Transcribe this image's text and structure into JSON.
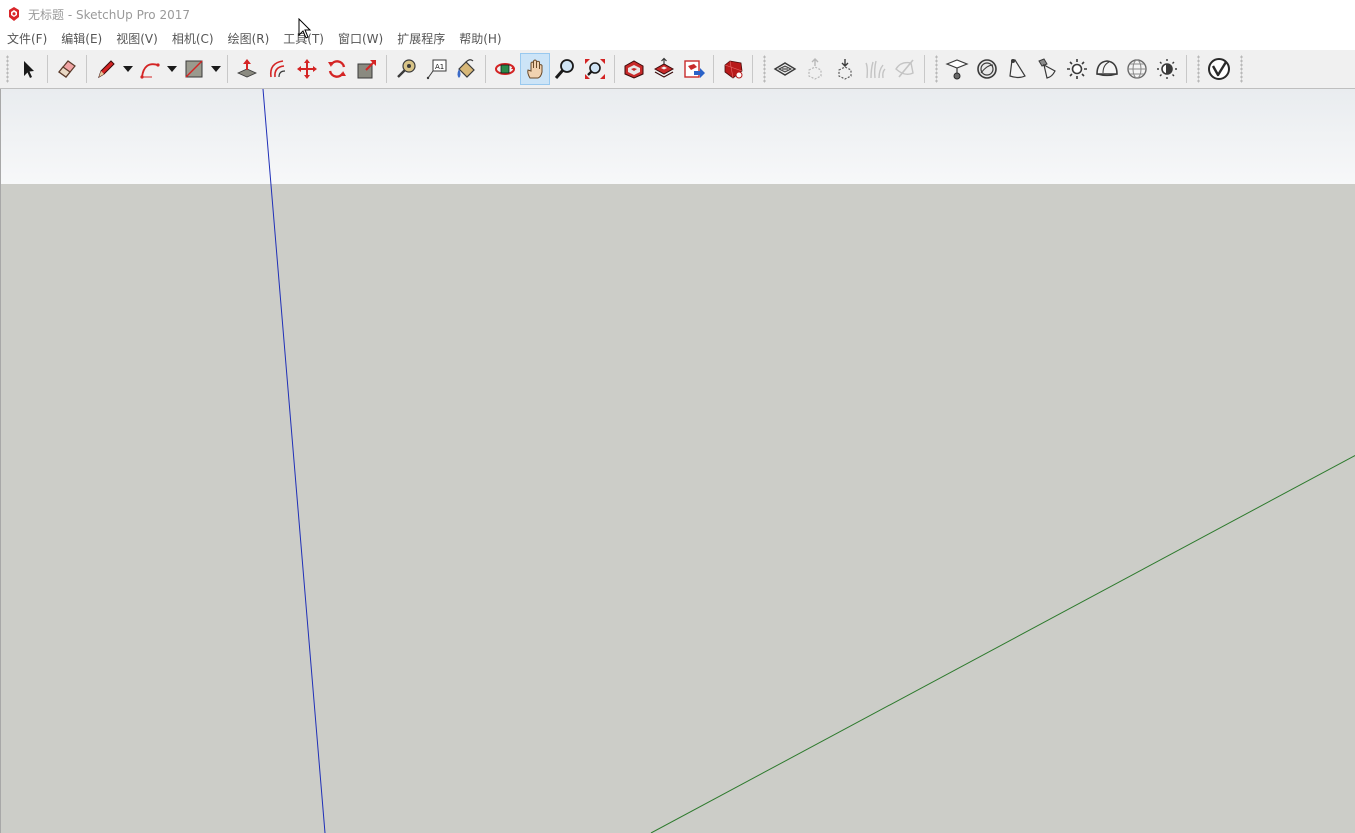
{
  "window": {
    "title": "无标题 - SketchUp Pro 2017",
    "app_icon": "sketchup-logo-icon"
  },
  "menu": [
    {
      "label": "文件(F)"
    },
    {
      "label": "编辑(E)"
    },
    {
      "label": "视图(V)"
    },
    {
      "label": "相机(C)"
    },
    {
      "label": "绘图(R)"
    },
    {
      "label": "工具(T)"
    },
    {
      "label": "窗口(W)"
    },
    {
      "label": "扩展程序"
    },
    {
      "label": "帮助(H)"
    }
  ],
  "toolbar": {
    "tools": [
      {
        "icon": "select-arrow-icon"
      },
      {
        "icon": "eraser-icon"
      },
      {
        "icon": "pencil-line-icon"
      },
      {
        "icon": "arc-icon"
      },
      {
        "icon": "rectangle-shape-icon"
      },
      {
        "icon": "push-pull-icon"
      },
      {
        "icon": "offset-icon"
      },
      {
        "icon": "move-icon"
      },
      {
        "icon": "rotate-icon"
      },
      {
        "icon": "scale-icon"
      },
      {
        "icon": "tape-measure-icon"
      },
      {
        "icon": "text-label-icon"
      },
      {
        "icon": "paint-bucket-icon"
      },
      {
        "icon": "orbit-icon"
      },
      {
        "icon": "pan-hand-icon",
        "active": true
      },
      {
        "icon": "zoom-icon"
      },
      {
        "icon": "zoom-extents-icon"
      },
      {
        "icon": "3d-warehouse-icon"
      },
      {
        "icon": "share-model-icon"
      },
      {
        "icon": "extension-warehouse-icon"
      },
      {
        "icon": "ruby-extension-icon"
      },
      {
        "icon": "section-plane-icon"
      },
      {
        "icon": "add-location-icon"
      },
      {
        "icon": "preview-terrain-icon"
      },
      {
        "icon": "sandbox-grass-icon"
      },
      {
        "icon": "section-cut-icon"
      },
      {
        "icon": "vray-camera-icon"
      },
      {
        "icon": "vray-sphere-light-icon"
      },
      {
        "icon": "vray-spot-light-icon"
      },
      {
        "icon": "vray-ies-light-icon"
      },
      {
        "icon": "vray-omni-light-icon"
      },
      {
        "icon": "vray-dome-light-icon"
      },
      {
        "icon": "vray-sphere-mesh-icon"
      },
      {
        "icon": "vray-mesh-light-icon"
      },
      {
        "icon": "vray-logo-icon"
      }
    ]
  },
  "viewport": {
    "sky_color": "#eef0f2",
    "ground_color": "#cccdc8",
    "blue_axis_color": "#1f2fb8",
    "green_axis_color": "#2d7a2d"
  }
}
